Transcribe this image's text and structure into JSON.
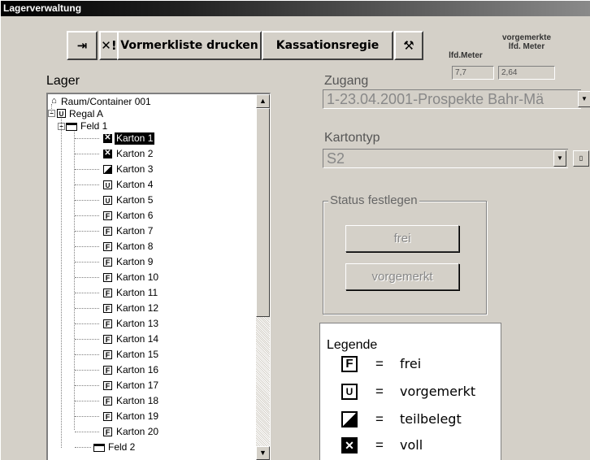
{
  "window": {
    "title": "Lagerverwaltung"
  },
  "toolbar": {
    "exit_icon": "exit-door-icon",
    "delete_icon": "delete-mark-icon",
    "print_label": "Vormerkliste drucken",
    "kassation_label": "Kassationsregie",
    "tool_icon": "hammer-icon"
  },
  "stats": {
    "lfd_header": "lfd.Meter",
    "vorgemerkt_header_1": "vorgemerkte",
    "vorgemerkt_header_2": "lfd. Meter",
    "lfd_value": "7,7",
    "vorgemerkt_value": "2,64"
  },
  "lager": {
    "label": "Lager",
    "tree": {
      "root": "Raum/Container 001",
      "regal": "Regal A",
      "feld1": "Feld 1",
      "feld2": "Feld 2",
      "cartons": [
        {
          "label": "Karton 1",
          "status": "voll"
        },
        {
          "label": "Karton 2",
          "status": "voll"
        },
        {
          "label": "Karton 3",
          "status": "teilbelegt"
        },
        {
          "label": "Karton 4",
          "status": "vorgemerkt"
        },
        {
          "label": "Karton 5",
          "status": "vorgemerkt"
        },
        {
          "label": "Karton 6",
          "status": "frei"
        },
        {
          "label": "Karton 7",
          "status": "frei"
        },
        {
          "label": "Karton 8",
          "status": "frei"
        },
        {
          "label": "Karton 9",
          "status": "frei"
        },
        {
          "label": "Karton 10",
          "status": "frei"
        },
        {
          "label": "Karton 11",
          "status": "frei"
        },
        {
          "label": "Karton 12",
          "status": "frei"
        },
        {
          "label": "Karton 13",
          "status": "frei"
        },
        {
          "label": "Karton 14",
          "status": "frei"
        },
        {
          "label": "Karton 15",
          "status": "frei"
        },
        {
          "label": "Karton 16",
          "status": "frei"
        },
        {
          "label": "Karton 17",
          "status": "frei"
        },
        {
          "label": "Karton 18",
          "status": "frei"
        },
        {
          "label": "Karton 19",
          "status": "frei"
        },
        {
          "label": "Karton 20",
          "status": "frei"
        }
      ]
    }
  },
  "zugang": {
    "label": "Zugang",
    "value": "1-23.04.2001-Prospekte  Bahr-Mä"
  },
  "kartontyp": {
    "label": "Kartontyp",
    "value": "S2"
  },
  "status": {
    "title": "Status festlegen",
    "frei_label": "frei",
    "vorgemerkt_label": "vorgemerkt"
  },
  "legend": {
    "title": "Legende",
    "eq": "=",
    "items": [
      {
        "glyph": "F",
        "text": "frei"
      },
      {
        "glyph": "U",
        "text": "vorgemerkt"
      },
      {
        "glyph": "",
        "text": "teilbelegt"
      },
      {
        "glyph": "✕",
        "text": "voll"
      }
    ]
  }
}
